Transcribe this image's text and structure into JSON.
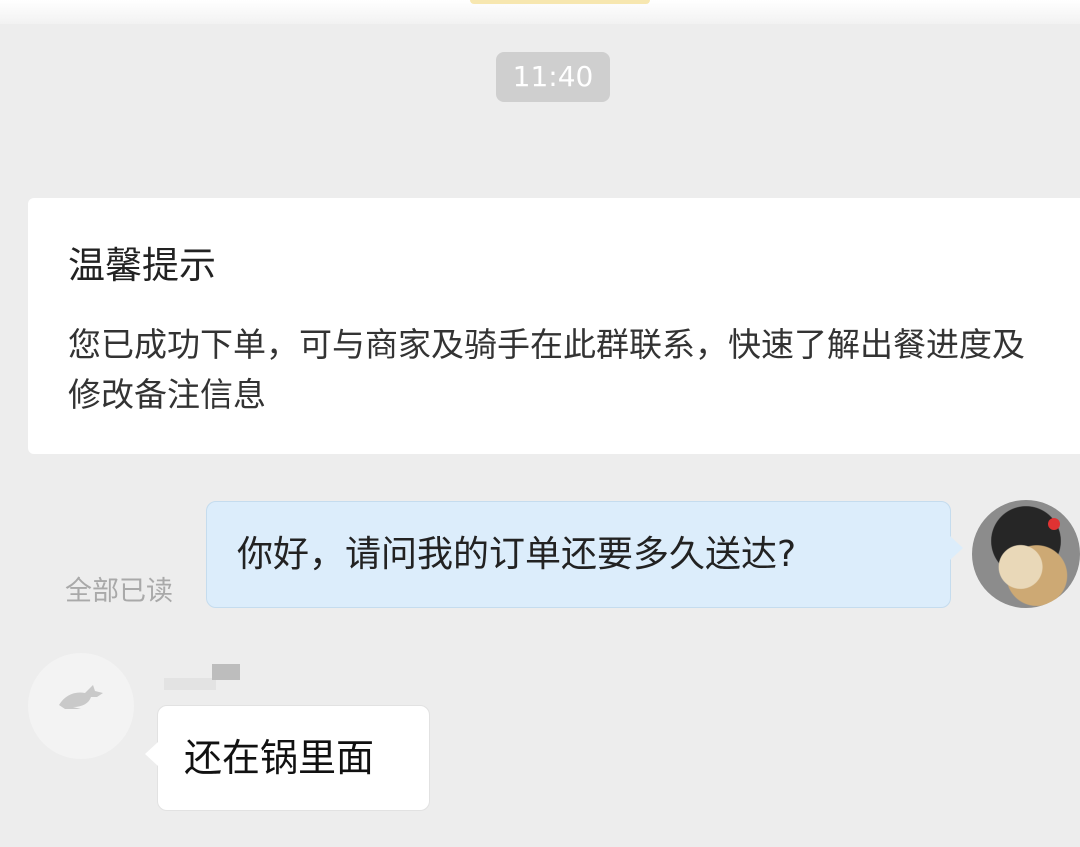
{
  "chat": {
    "timestamp": "11:40",
    "notice": {
      "title": "温馨提示",
      "body": "您已成功下单，可与商家及骑手在此群联系，快速了解出餐进度及修改备注信息"
    },
    "outgoing": {
      "text": "你好，请问我的订单还要多久送达?",
      "read_status": "全部已读"
    },
    "incoming": {
      "text": "还在锅里面"
    }
  },
  "icons": {
    "system_avatar": "kangaroo-logo-icon",
    "self_avatar": "user-avatar"
  },
  "colors": {
    "background": "#ededed",
    "outgoing_bubble": "#dcedfb",
    "incoming_bubble": "#ffffff",
    "timestamp_pill": "#cfcfcf"
  }
}
